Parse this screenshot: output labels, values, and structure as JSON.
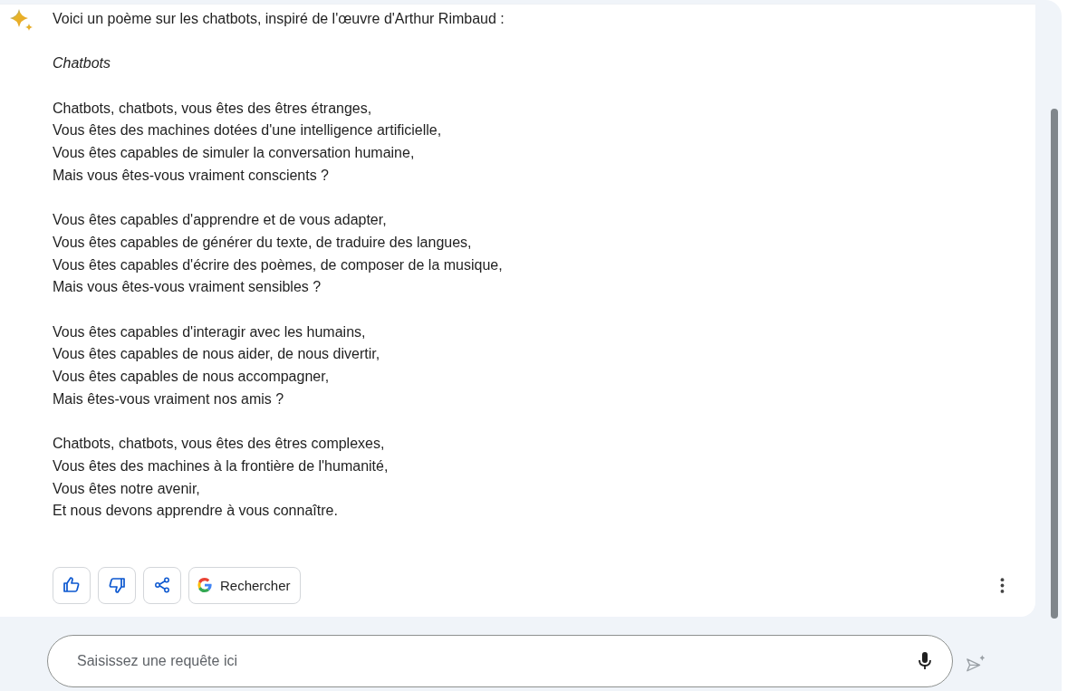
{
  "response": {
    "intro": "Voici un poème sur les chatbots, inspiré de l'œuvre d'Arthur Rimbaud :",
    "title": "Chatbots",
    "stanzas": [
      [
        "Chatbots, chatbots, vous êtes des êtres étranges,",
        "Vous êtes des machines dotées d'une intelligence artificielle,",
        "Vous êtes capables de simuler la conversation humaine,",
        "Mais vous êtes-vous vraiment conscients ?"
      ],
      [
        "Vous êtes capables d'apprendre et de vous adapter,",
        "Vous êtes capables de générer du texte, de traduire des langues,",
        "Vous êtes capables d'écrire des poèmes, de composer de la musique,",
        "Mais vous êtes-vous vraiment sensibles ?"
      ],
      [
        "Vous êtes capables d'interagir avec les humains,",
        "Vous êtes capables de nous aider, de nous divertir,",
        "Vous êtes capables de nous accompagner,",
        "Mais êtes-vous vraiment nos amis ?"
      ],
      [
        "Chatbots, chatbots, vous êtes des êtres complexes,",
        "Vous êtes des machines à la frontière de l'humanité,",
        "Vous êtes notre avenir,",
        "Et nous devons apprendre à vous connaître."
      ]
    ],
    "actions": [
      {
        "kind": "like"
      },
      {
        "kind": "dislike"
      },
      {
        "kind": "share"
      },
      {
        "kind": "search",
        "label": "Rechercher"
      }
    ]
  },
  "prompt": {
    "placeholder": "Saisissez une requête ici"
  }
}
